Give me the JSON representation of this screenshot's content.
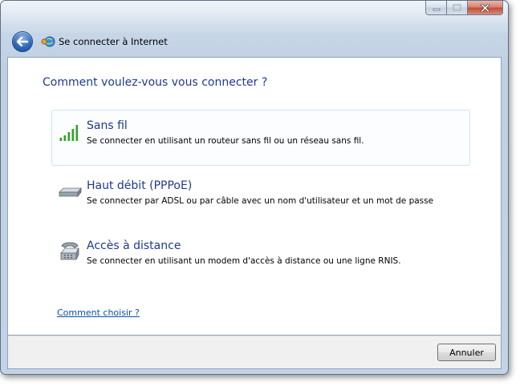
{
  "window": {
    "title": "Se connecter à Internet",
    "title_icon": "network-globe-icon"
  },
  "caption": {
    "minimize_icon": "minimize-icon",
    "maximize_icon": "maximize-icon",
    "close_icon": "close-icon"
  },
  "nav": {
    "back_icon": "back-arrow-icon"
  },
  "content": {
    "heading": "Comment voulez-vous vous connecter ?",
    "options": [
      {
        "title": "Sans fil",
        "description": "Se connecter en utilisant un routeur sans fil ou un réseau sans fil.",
        "icon": "wireless-signal-icon",
        "highlighted": true
      },
      {
        "title": "Haut débit (PPPoE)",
        "description": "Se connecter par ADSL ou par câble avec un nom d'utilisateur et un mot de passe",
        "icon": "modem-device-icon",
        "highlighted": false
      },
      {
        "title": "Accès à distance",
        "description": "Se connecter en utilisant un modem d'accès à distance ou une ligne RNIS.",
        "icon": "telephone-icon",
        "highlighted": false
      }
    ],
    "help_link": "Comment choisir ?"
  },
  "footer": {
    "cancel_label": "Annuler"
  },
  "colors": {
    "heading": "#1e3b8a",
    "link": "#0b4fa8",
    "signal_green": "#2f9e2f"
  }
}
